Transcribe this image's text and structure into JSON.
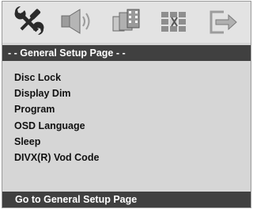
{
  "toolbar": {
    "icons": [
      {
        "name": "general-setup-tools-icon"
      },
      {
        "name": "audio-speaker-icon"
      },
      {
        "name": "video-film-icon"
      },
      {
        "name": "preference-grid-icon"
      },
      {
        "name": "exit-arrow-icon"
      }
    ]
  },
  "header": {
    "title": "- -  General Setup Page  - -"
  },
  "menu": {
    "items": [
      {
        "label": "Disc Lock"
      },
      {
        "label": "Display Dim"
      },
      {
        "label": "Program"
      },
      {
        "label": "OSD Language"
      },
      {
        "label": "Sleep"
      },
      {
        "label": "DIVX(R) Vod Code"
      }
    ]
  },
  "status": {
    "text": "Go to General Setup Page"
  },
  "colors": {
    "background": "#d6d6d6",
    "bar": "#404040",
    "icon_dark": "#2a2a2a",
    "icon_light": "#9c9c9c"
  }
}
